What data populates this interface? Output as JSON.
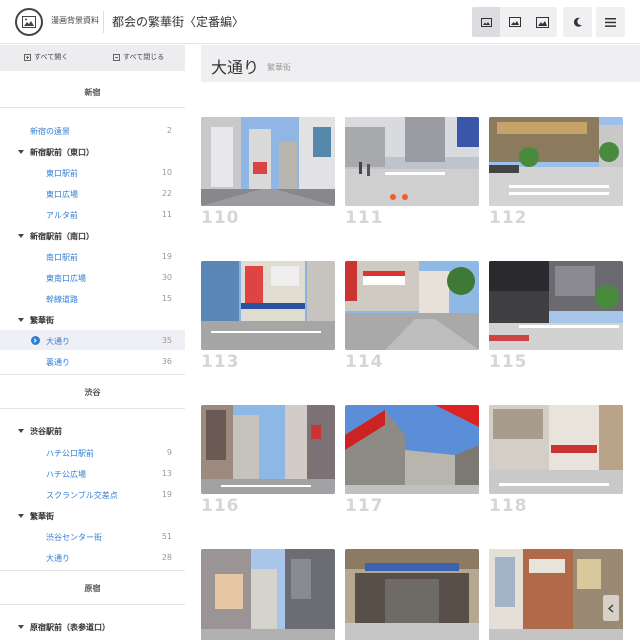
{
  "header": {
    "site_name": "漫画背景資料",
    "title": "都会の繁華街〈定番編〉",
    "buttons": [
      {
        "icon": "image-small-icon",
        "active": true
      },
      {
        "icon": "image-medium-icon",
        "active": false
      },
      {
        "icon": "image-large-icon",
        "active": false
      },
      {
        "icon": "moon-icon",
        "active": false
      },
      {
        "icon": "menu-icon",
        "active": false
      }
    ]
  },
  "sidebar": {
    "expand_all": "すべて開く",
    "collapse_all": "すべて閉じる",
    "sections": {
      "shinjuku": "新宿",
      "shibuya": "渋谷",
      "harajuku": "原宿"
    },
    "items": {
      "s0": {
        "label": "新宿の遠景",
        "count": "2"
      },
      "s1": {
        "label": "新宿駅前（東口）"
      },
      "s2": {
        "label": "東口駅前",
        "count": "10"
      },
      "s3": {
        "label": "東口広場",
        "count": "22"
      },
      "s4": {
        "label": "アルタ前",
        "count": "11"
      },
      "s5": {
        "label": "新宿駅前（南口）"
      },
      "s6": {
        "label": "南口駅前",
        "count": "19"
      },
      "s7": {
        "label": "東南口広場",
        "count": "30"
      },
      "s8": {
        "label": "幹線道路",
        "count": "15"
      },
      "s9": {
        "label": "繁華街"
      },
      "s10": {
        "label": "大通り",
        "count": "35"
      },
      "s11": {
        "label": "裏通り",
        "count": "36"
      },
      "b0": {
        "label": "渋谷駅前"
      },
      "b1": {
        "label": "ハチ公口駅前",
        "count": "9"
      },
      "b2": {
        "label": "ハチ公広場",
        "count": "13"
      },
      "b3": {
        "label": "スクランブル交差点",
        "count": "19"
      },
      "b4": {
        "label": "繁華街"
      },
      "b5": {
        "label": "渋谷センター街",
        "count": "51"
      },
      "b6": {
        "label": "大通り",
        "count": "28"
      },
      "h0": {
        "label": "原宿駅前（表参道口）"
      }
    }
  },
  "main": {
    "title": "大通り",
    "subtitle": "繁華街",
    "thumbnails": [
      "110",
      "111",
      "112",
      "113",
      "114",
      "115",
      "116",
      "117",
      "118"
    ]
  },
  "colors": {
    "accent": "#2f7ed6",
    "sidebar_bar": "#ededf0",
    "number_gray": "#d6d6d6"
  }
}
